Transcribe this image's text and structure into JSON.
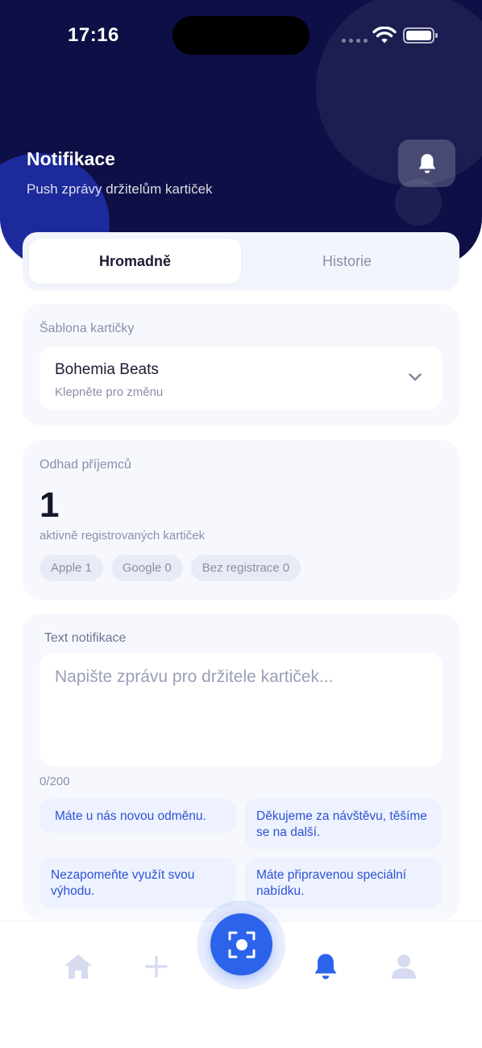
{
  "status_bar": {
    "time": "17:16"
  },
  "header": {
    "title": "Notifikace",
    "subtitle": "Push zprávy držitelům kartiček",
    "bell_icon": "bell-icon"
  },
  "tabs": [
    {
      "label": "Hromadně",
      "active": true
    },
    {
      "label": "Historie",
      "active": false
    }
  ],
  "template_card": {
    "label": "Šablona kartičky",
    "selected_value": "Bohemia Beats",
    "hint": "Klepněte pro změnu"
  },
  "recipients_card": {
    "label": "Odhad příjemců",
    "count": "1",
    "count_caption": "aktivně registrovaných kartiček",
    "chips": [
      "Apple 1",
      "Google 0",
      "Bez registrace 0"
    ]
  },
  "message_card": {
    "label": "Text notifikace",
    "value": "",
    "placeholder": "Napište zprávu pro držitele kartiček...",
    "char_count": "0/200",
    "suggestions": [
      "Máte u nás novou odměnu.",
      "Děkujeme za návštěvu, těšíme se na další.",
      "Nezapomeňte využít svou výhodu.",
      "Máte připravenou speciální nabídku."
    ]
  },
  "bottom_nav": {
    "items": [
      "home-icon",
      "plus-icon",
      "scan-icon",
      "bell-icon",
      "profile-icon"
    ],
    "active": "bell-icon"
  },
  "colors": {
    "header_bg": "#0e0f46",
    "accent": "#2b63ea",
    "suggestion_text": "#2d52d6",
    "inactive_icon": "#d7dbf0"
  }
}
